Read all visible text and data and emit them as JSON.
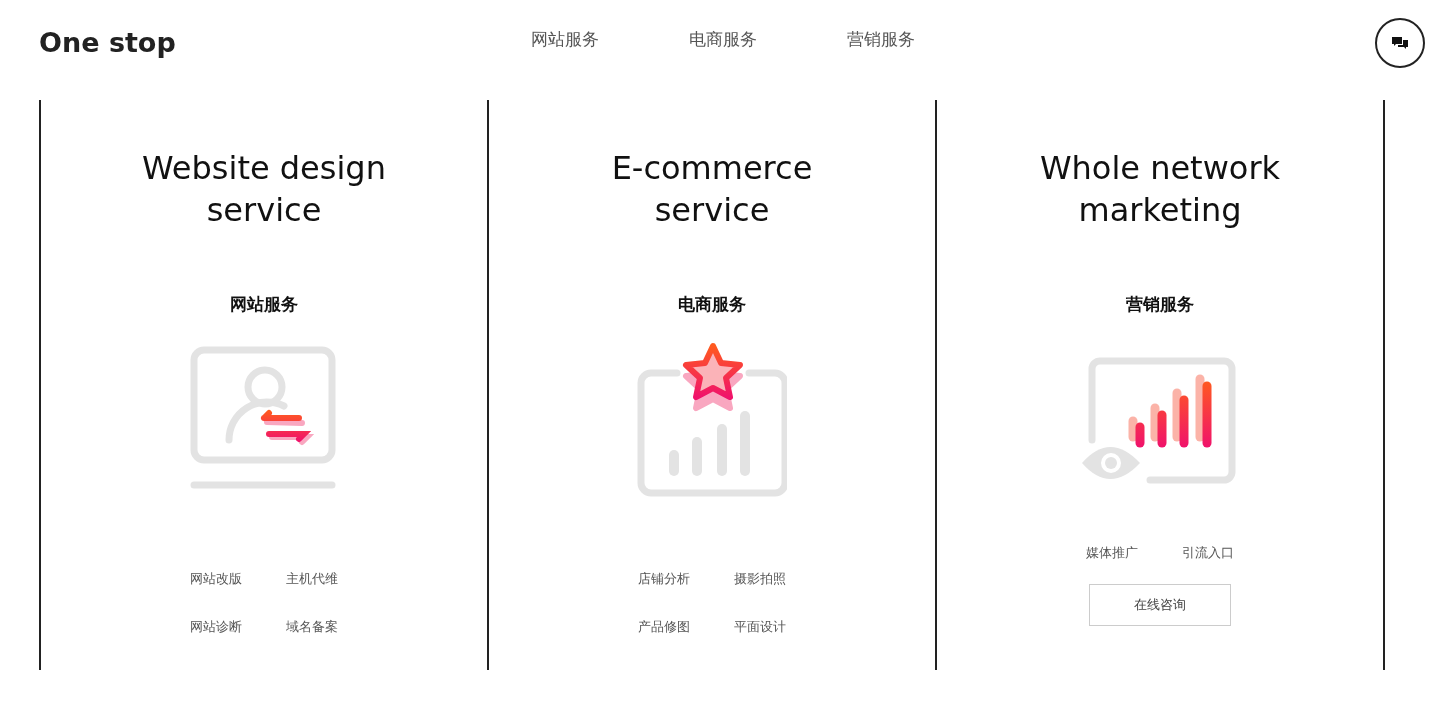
{
  "logo": "One stop",
  "nav": [
    "网站服务",
    "电商服务",
    "营销服务"
  ],
  "cards": [
    {
      "title": "Website design service",
      "subtitle": "网站服务",
      "links": [
        "网站改版",
        "主机代维",
        "网站诊断",
        "域名备案"
      ]
    },
    {
      "title": "E-commerce service",
      "subtitle": "电商服务",
      "links": [
        "店铺分析",
        "摄影拍照",
        "产品修图",
        "平面设计"
      ]
    },
    {
      "title": "Whole network marketing",
      "subtitle": "营销服务",
      "links": [
        "媒体推广",
        "引流入口"
      ],
      "button": "在线咨询"
    }
  ]
}
